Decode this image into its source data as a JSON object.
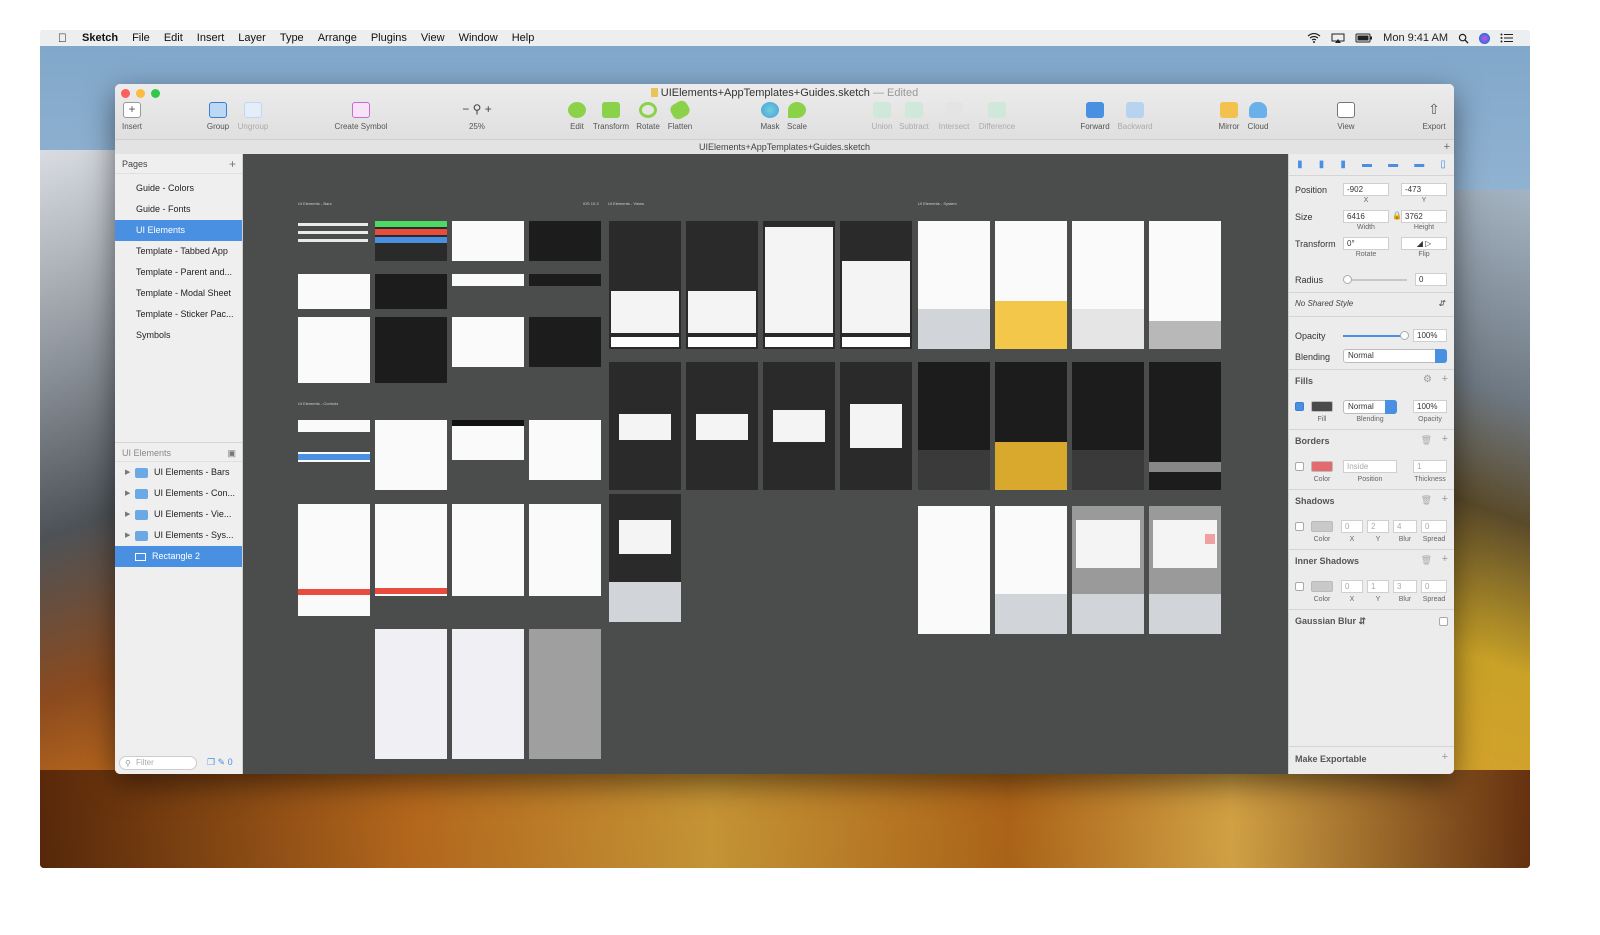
{
  "menubar": {
    "app": "Sketch",
    "items": [
      "File",
      "Edit",
      "Insert",
      "Layer",
      "Type",
      "Arrange",
      "Plugins",
      "View",
      "Window",
      "Help"
    ],
    "clock": "Mon 9:41 AM"
  },
  "window": {
    "title": "UIElements+AppTemplates+Guides.sketch",
    "title_suffix": "— Edited",
    "tab_title": "UIElements+AppTemplates+Guides.sketch"
  },
  "toolbar": {
    "insert": "Insert",
    "group": "Group",
    "ungroup": "Ungroup",
    "create_symbol": "Create Symbol",
    "zoom": "25%",
    "edit": "Edit",
    "transform": "Transform",
    "rotate": "Rotate",
    "flatten": "Flatten",
    "mask": "Mask",
    "scale": "Scale",
    "union": "Union",
    "subtract": "Subtract",
    "intersect": "Intersect",
    "difference": "Difference",
    "forward": "Forward",
    "backward": "Backward",
    "mirror": "Mirror",
    "cloud": "Cloud",
    "view": "View",
    "export": "Export"
  },
  "sidebar": {
    "pages_header": "Pages",
    "pages": [
      "Guide - Colors",
      "Guide - Fonts",
      "UI Elements",
      "Template - Tabbed App",
      "Template - Parent and...",
      "Template - Modal Sheet",
      "Template - Sticker Pac...",
      "Symbols"
    ],
    "selected_page": "UI Elements",
    "layers_header": "UI Elements",
    "layers": [
      "UI Elements - Bars",
      "UI Elements - Con...",
      "UI Elements - Vie...",
      "UI Elements - Sys...",
      "Rectangle 2"
    ],
    "filter_placeholder": "Filter",
    "layer_count": "0"
  },
  "canvas": {
    "label_bars": "UI Elements - Bars",
    "label_ios": "iOS 10.3",
    "label_views": "UI Elements - Views",
    "label_system": "UI Elements - System",
    "label_controls": "UI Elements - Controls"
  },
  "inspector": {
    "position_label": "Position",
    "x": "-902",
    "y": "-473",
    "x_sub": "X",
    "y_sub": "Y",
    "size_label": "Size",
    "width": "6416",
    "height": "3762",
    "width_sub": "Width",
    "height_sub": "Height",
    "transform_label": "Transform",
    "rotate": "0°",
    "rotate_sub": "Rotate",
    "flip_sub": "Flip",
    "radius_label": "Radius",
    "radius": "0",
    "shared_style": "No Shared Style",
    "opacity_label": "Opacity",
    "opacity": "100%",
    "opacity_level": 1.0,
    "blending_label": "Blending",
    "blending": "Normal",
    "fills_label": "Fills",
    "fill_color": "#4a4a4a",
    "fill_blending": "Normal",
    "fill_opacity": "100%",
    "fill_sub": "Fill",
    "fill_blending_sub": "Blending",
    "fill_opacity_sub": "Opacity",
    "borders_label": "Borders",
    "border_color": "#e36a6f",
    "border_position": "Inside",
    "border_thickness": "1",
    "color_sub": "Color",
    "position_sub": "Position",
    "thickness_sub": "Thickness",
    "shadows_label": "Shadows",
    "shadow_x": "0",
    "shadow_y": "2",
    "shadow_blur": "4",
    "shadow_spread": "0",
    "x_col": "X",
    "y_col": "Y",
    "blur_col": "Blur",
    "spread_col": "Spread",
    "inner_shadows_label": "Inner Shadows",
    "inner_x": "0",
    "inner_y": "1",
    "inner_blur": "3",
    "inner_spread": "0",
    "gaussian_blur": "Gaussian Blur",
    "make_exportable": "Make Exportable"
  }
}
